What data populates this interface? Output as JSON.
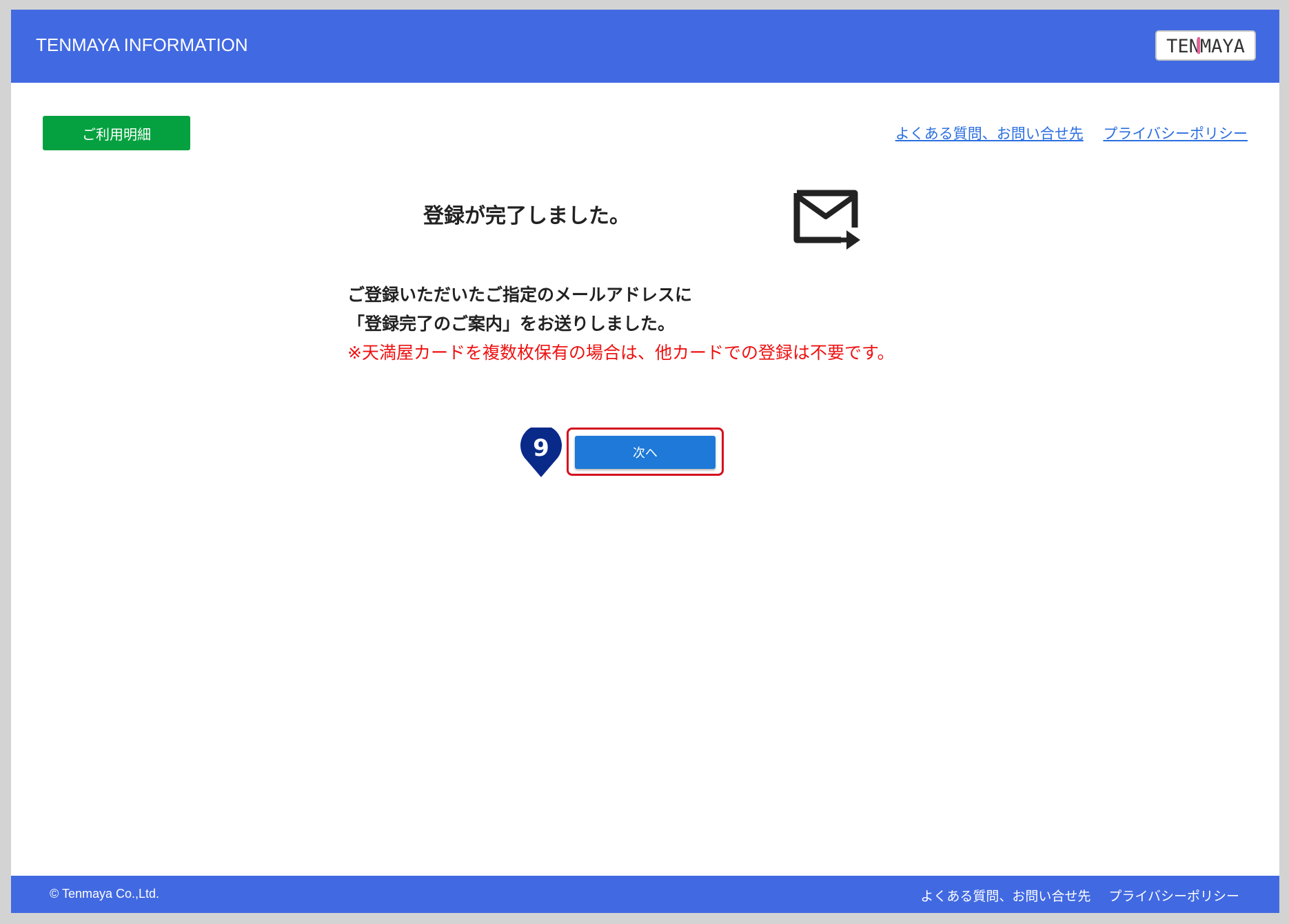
{
  "header": {
    "title": "TENMAYA INFORMATION",
    "logo_text": "TENMAYA"
  },
  "nav": {
    "usage_button": "ご利用明細",
    "faq_link": "よくある質問、お問い合せ先",
    "privacy_link": "プライバシーポリシー"
  },
  "main": {
    "title": "登録が完了しました。",
    "message_line1": "ご登録いただいたご指定のメールアドレスに",
    "message_line2": "「登録完了のご案内」をお送りしました。",
    "notice": "※天満屋カードを複数枚保有の場合は、他カードでの登録は不要です。",
    "step_marker": "9",
    "next_button": "次へ",
    "icon": "mail-forward-icon"
  },
  "footer": {
    "copyright": "© Tenmaya Co.,Ltd.",
    "faq_link": "よくある質問、お問い合せ先",
    "privacy_link": "プライバシーポリシー"
  },
  "colors": {
    "header_bg": "#4169e1",
    "usage_button_bg": "#05a140",
    "link": "#2a6ee0",
    "notice": "#ee1111",
    "next_button_bg": "#1e79d8",
    "highlight_border": "#d40f1f",
    "marker": "#0a2a8a"
  }
}
